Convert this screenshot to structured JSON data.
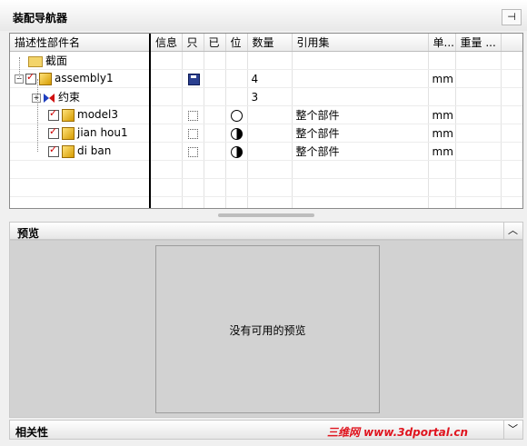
{
  "window": {
    "title": "装配导航器",
    "pin_icon": "pin-icon"
  },
  "table": {
    "columns": [
      "描述性部件名",
      "信息",
      "只",
      "已",
      "位",
      "数量",
      "引用集",
      "单...",
      "重量 ..."
    ],
    "rows": [
      {
        "name": "截面",
        "qty": "",
        "refset": "",
        "unit": ""
      },
      {
        "name": "assembly1",
        "qty": "4",
        "refset": "",
        "unit": "mm"
      },
      {
        "name": "约束",
        "qty": "3",
        "refset": "",
        "unit": ""
      },
      {
        "name": "model3",
        "qty": "",
        "refset": "整个部件",
        "unit": "mm"
      },
      {
        "name": "jian hou1",
        "qty": "",
        "refset": "整个部件",
        "unit": "mm"
      },
      {
        "name": "di ban",
        "qty": "",
        "refset": "整个部件",
        "unit": "mm"
      }
    ]
  },
  "preview": {
    "title": "预览",
    "message": "没有可用的预览"
  },
  "related": {
    "title": "相关性"
  },
  "watermark": "三维网 www.3dportal.cn",
  "colors": {
    "check_red": "#d00000",
    "watermark_red": "#e0141e"
  }
}
